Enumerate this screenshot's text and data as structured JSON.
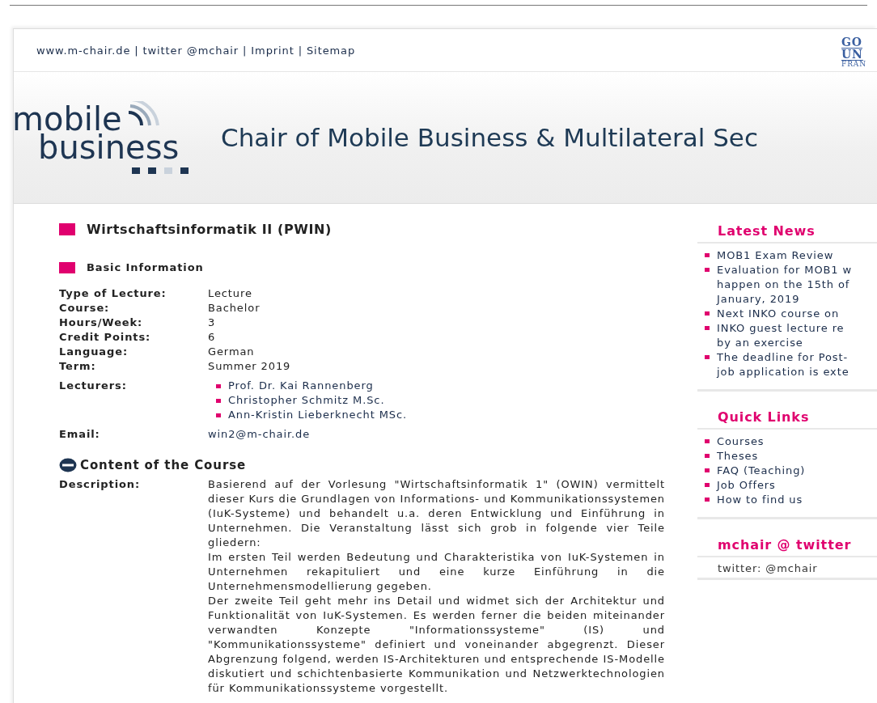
{
  "top_links": [
    "www.m-chair.de",
    "twitter @mchair",
    "Imprint",
    "Sitemap"
  ],
  "top_links_separator": "|",
  "university_logo": [
    "GO",
    "UN",
    "FRAN"
  ],
  "logo": {
    "line1": "mobile",
    "line2": "business"
  },
  "header_title": "Chair of Mobile Business & Multilateral Sec",
  "page_title": "Wirtschaftsinformatik II (PWIN)",
  "basic_information": {
    "heading": "Basic Information",
    "rows": [
      {
        "label": "Type of Lecture:",
        "value": "Lecture"
      },
      {
        "label": "Course:",
        "value": "Bachelor"
      },
      {
        "label": "Hours/Week:",
        "value": "3"
      },
      {
        "label": "Credit Points:",
        "value": "6"
      },
      {
        "label": "Language:",
        "value": "German"
      },
      {
        "label": "Term:",
        "value": "Summer 2019"
      }
    ],
    "lecturers_label": "Lecturers:",
    "lecturers": [
      "Prof. Dr. Kai Rannenberg",
      "Christopher Schmitz M.Sc.",
      "Ann-Kristin Lieberknecht MSc."
    ],
    "email_label": "Email:",
    "email": "win2@m-chair.de"
  },
  "content": {
    "heading": "Content of the Course",
    "expanded": true,
    "description_label": "Description:",
    "paragraphs": [
      "Basierend auf der Vorlesung \"Wirtschaftsinformatik 1\" (OWIN) vermittelt dieser Kurs die Grundlagen von Informations- und Kommunikationssystemen (IuK-Systeme) und behandelt u.a. deren Entwicklung und Einführung in Unternehmen. Die Veranstaltung lässt sich grob in folgende vier Teile gliedern:",
      "Im ersten Teil werden Bedeutung und Charakteristika von IuK-Systemen in Unternehmen rekapituliert und eine kurze Einführung in die Unternehmensmodellierung gegeben.",
      "Der zweite Teil geht mehr ins Detail und widmet sich der Architektur und Funktionalität von IuK-Systemen. Es werden ferner die beiden miteinander verwandten Konzepte \"Informationssysteme\" (IS) und \"Kommunikationssysteme\" definiert und voneinander abgegrenzt. Dieser Abgrenzung folgend, werden IS-Architekturen und entsprechende IS-Modelle diskutiert und schichtenbasierte Kommunikation und Netzwerktechnologien für Kommunikationssysteme vorgestellt."
    ]
  },
  "sidebar": [
    {
      "heading": "Latest News",
      "items": [
        {
          "lines": [
            "MOB1 Exam Review"
          ]
        },
        {
          "lines": [
            "Evaluation for MOB1 w",
            "happen on the 15th of",
            "January, 2019"
          ]
        },
        {
          "lines": [
            "Next INKO course on"
          ]
        },
        {
          "lines": [
            "INKO guest lecture re",
            "by an exercise"
          ]
        },
        {
          "lines": [
            "The deadline for Post-",
            "job application is exte"
          ]
        }
      ]
    },
    {
      "heading": "Quick Links",
      "items": [
        {
          "lines": [
            "Courses"
          ]
        },
        {
          "lines": [
            "Theses"
          ]
        },
        {
          "lines": [
            "FAQ (Teaching)"
          ]
        },
        {
          "lines": [
            "Job Offers"
          ]
        },
        {
          "lines": [
            "How to find us"
          ]
        }
      ]
    },
    {
      "heading": "mchair @ twitter",
      "text": "twitter: @mchair"
    }
  ]
}
